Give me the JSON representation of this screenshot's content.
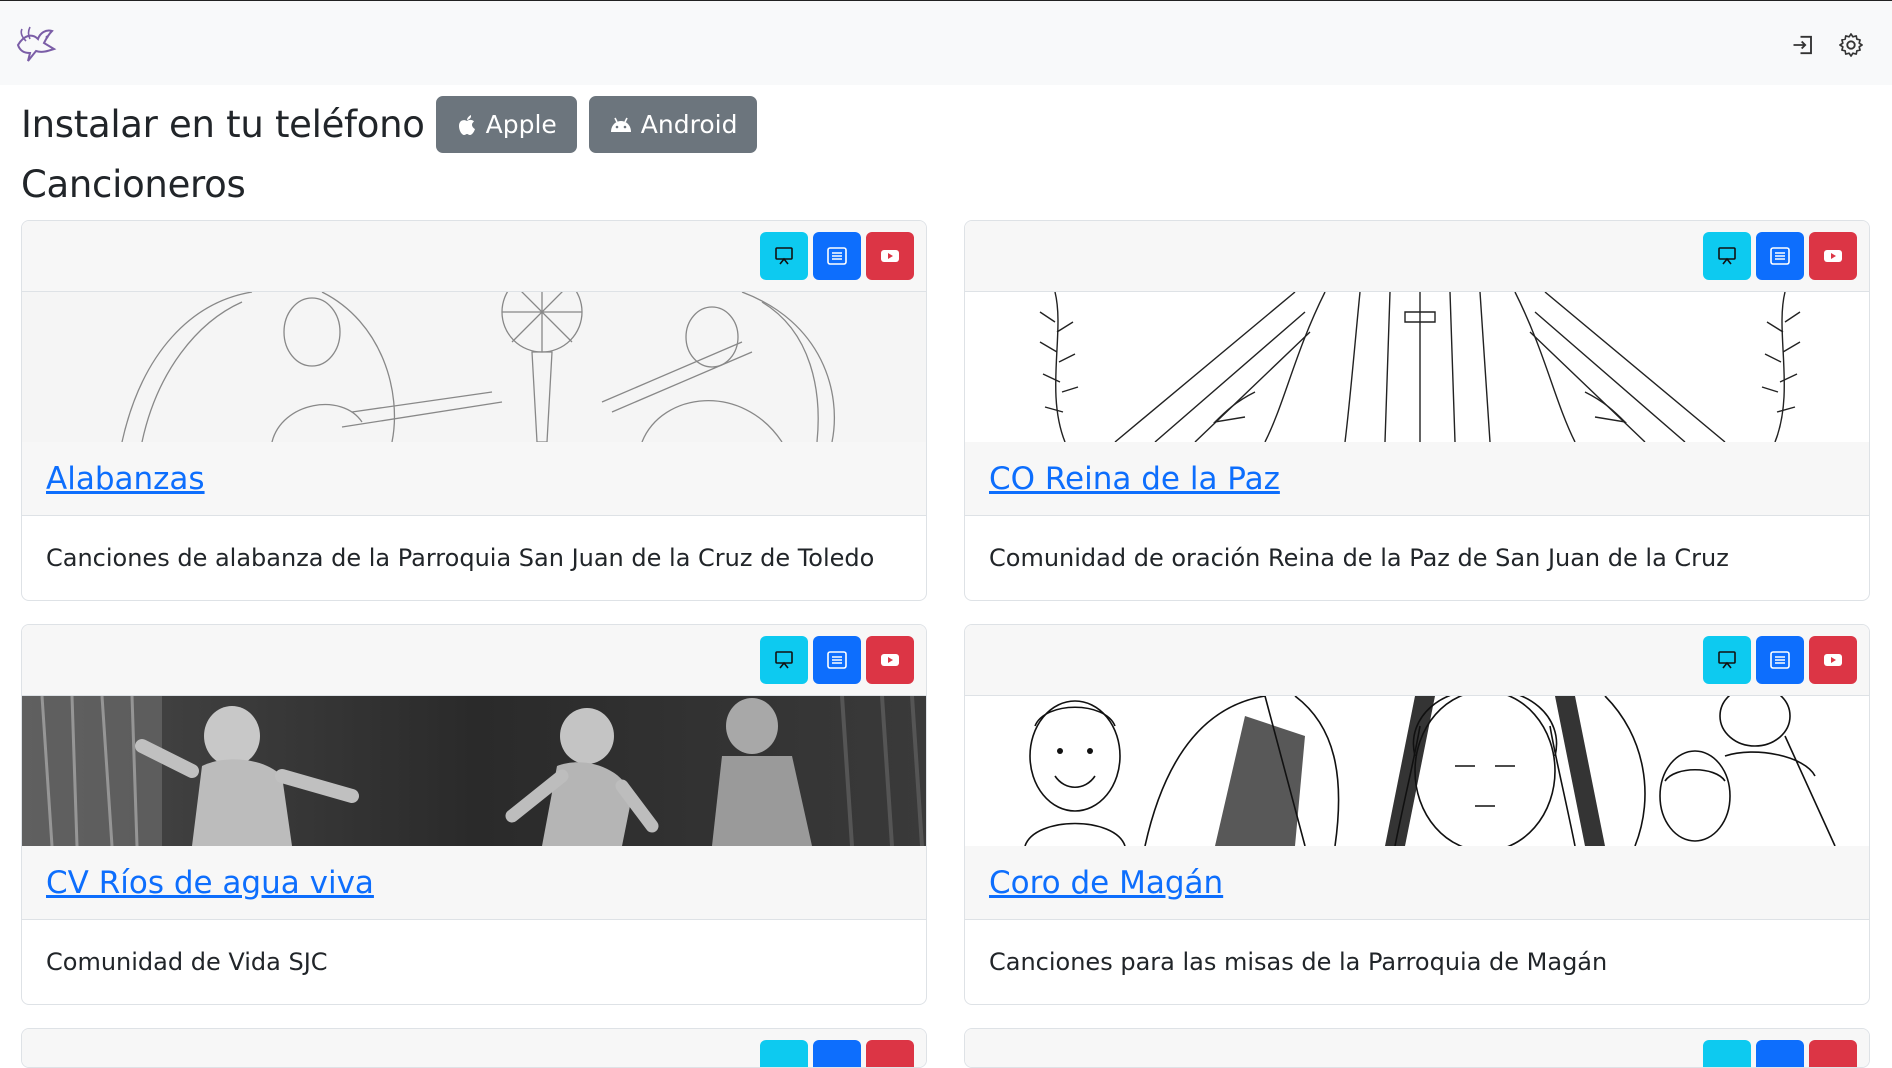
{
  "navbar": {
    "logo_icon": "dove-icon",
    "login_icon": "login-icon",
    "settings_icon": "gear-icon"
  },
  "install": {
    "title": "Instalar en tu teléfono",
    "apple_label": "Apple",
    "android_label": "Android"
  },
  "section": {
    "title": "Cancioneros"
  },
  "cards": [
    {
      "title": "Alabanzas",
      "description": "Canciones de alabanza de la Parroquia San Juan de la Cruz de Toledo"
    },
    {
      "title": "CO Reina de la Paz",
      "description": "Comunidad de oración Reina de la Paz de San Juan de la Cruz"
    },
    {
      "title": "CV Ríos de agua viva",
      "description": "Comunidad de Vida SJC"
    },
    {
      "title": "Coro de Magán",
      "description": "Canciones para las misas de la Parroquia de Magán"
    }
  ],
  "colors": {
    "present": "#0dcaf0",
    "list": "#0d6efd",
    "youtube": "#dc3545",
    "secondary": "#6c757d",
    "link": "#0d6efd"
  }
}
